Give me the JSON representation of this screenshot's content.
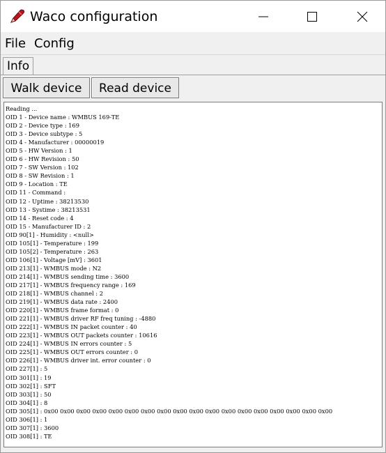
{
  "window": {
    "title": "Waco configuration",
    "icon": "red-pen-icon"
  },
  "menu": {
    "items": [
      "File",
      "Config"
    ]
  },
  "tabs": [
    {
      "label": "Info",
      "selected": true
    }
  ],
  "toolbar": {
    "walk_label": "Walk device",
    "read_label": "Read device"
  },
  "log": [
    "Reading ...",
    "OID 1 - Device name : WMBUS 169-TE",
    "OID 2 - Device type : 169",
    "OID 3 - Device subtype : 5",
    "OID 4 - Manufacturer : 00000019",
    "OID 5 - HW Version : 1",
    "OID 6 - HW Revision : 50",
    "OID 7 - SW Version : 102",
    "OID 8 - SW Revision : 1",
    "OID 9 - Location : TE",
    "OID 11 - Command :",
    "OID 12 - Uptime : 38213530",
    "OID 13 - Systime : 38213531",
    "OID 14 - Reset code : 4",
    "OID 15 - Manufacturer ID : 2",
    "OID 90[1] - Humidity : <null>",
    "OID 105[1] - Temperature : 199",
    "OID 105[2] - Temperature : 263",
    "OID 106[1] - Voltage [mV] : 3601",
    "OID 213[1] - WMBUS mode : N2",
    "OID 214[1] - WMBUS sending time : 3600",
    "OID 217[1] - WMBUS frequency range : 169",
    "OID 218[1] - WMBUS channel : 2",
    "OID 219[1] - WMBUS data rate : 2400",
    "OID 220[1] - WMBUS frame format : 0",
    "OID 221[1] - WMBUS driver RF freq tuning : -4880",
    "OID 222[1] - WMBUS IN packet counter : 40",
    "OID 223[1] - WMBUS OUT packets counter : 10616",
    "OID 224[1] - WMBUS IN errors counter : 5",
    "OID 225[1] - WMBUS OUT errors counter : 0",
    "OID 226[1] - WMBUS driver int. error counter : 0",
    "OID 227[1] : 5",
    "OID 301[1] : 19",
    "OID 302[1] : SFT",
    "OID 303[1] : 50",
    "OID 304[1] : 8",
    "OID 305[1] : 0x00 0x00 0x00 0x00 0x00 0x00 0x00 0x00 0x00 0x00 0x00 0x00 0x00 0x00 0x00 0x00 0x00 0x00",
    "OID 306[1] : 1",
    "OID 307[1] : 3600",
    "OID 308[1] : TE"
  ]
}
